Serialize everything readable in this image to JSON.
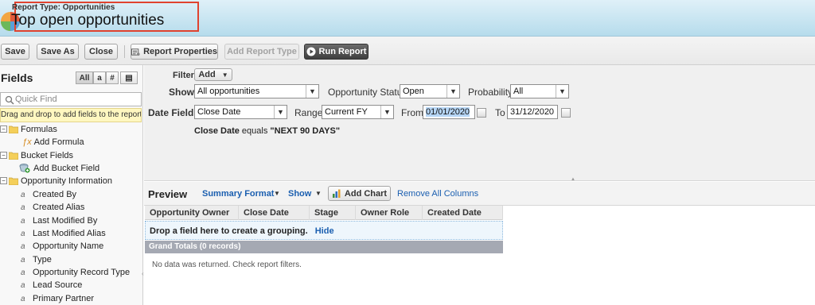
{
  "header": {
    "report_type": "Report Type: Opportunities",
    "title": "Top open opportunities"
  },
  "toolbar": {
    "save": "Save",
    "save_as": "Save As",
    "close": "Close",
    "report_properties": "Report Properties",
    "add_report_type": "Add Report Type",
    "run_report": "Run Report"
  },
  "fields_panel": {
    "title": "Fields",
    "view_all": "All",
    "view_text": "a",
    "view_number": "#",
    "view_date": "▤",
    "quick_find_placeholder": "Quick Find",
    "hint": "Drag and drop to add fields to the report.",
    "tree": [
      {
        "label": "Formulas"
      },
      {
        "label": "Add Formula"
      },
      {
        "label": "Bucket Fields"
      },
      {
        "label": "Add Bucket Field"
      },
      {
        "label": "Opportunity Information"
      },
      {
        "label": "Created By"
      },
      {
        "label": "Created Alias"
      },
      {
        "label": "Last Modified By"
      },
      {
        "label": "Last Modified Alias"
      },
      {
        "label": "Opportunity Name"
      },
      {
        "label": "Type"
      },
      {
        "label": "Opportunity Record Type"
      },
      {
        "label": "Lead Source"
      },
      {
        "label": "Primary Partner"
      }
    ]
  },
  "filters": {
    "label": "Filters",
    "add_button": "Add",
    "show_label": "Show",
    "show_value": "All opportunities",
    "status_label": "Opportunity Status",
    "status_value": "Open",
    "probability_label": "Probability",
    "probability_value": "All",
    "date_field_label": "Date Field",
    "date_field_value": "Close Date",
    "range_label": "Range",
    "range_value": "Current FY",
    "from_label": "From",
    "from_value": "01/01/2020",
    "to_label": "To",
    "to_value": "31/12/2020",
    "summary_prefix": "Close Date",
    "summary_equals": "equals",
    "summary_value": "\"NEXT 90 DAYS\""
  },
  "preview": {
    "title": "Preview",
    "format": "Summary Format",
    "show": "Show",
    "add_chart": "Add Chart",
    "remove_all": "Remove All Columns",
    "columns": [
      "Opportunity Owner",
      "Close Date",
      "Stage",
      "Owner Role",
      "Created Date"
    ],
    "dropzone_text": "Drop a field here to create a grouping.",
    "hide": "Hide",
    "grand_totals": "Grand Totals (0 records)",
    "no_data": "No data was returned. Check report filters."
  }
}
